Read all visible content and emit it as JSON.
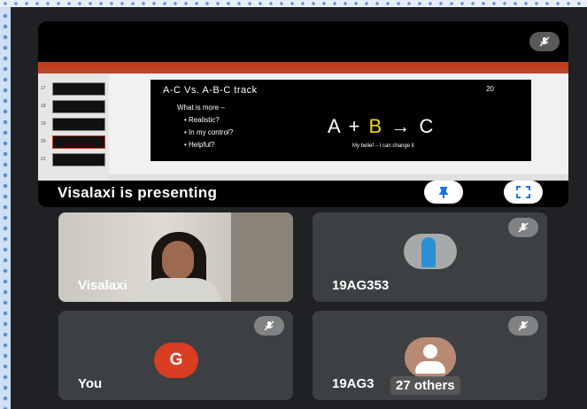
{
  "presentation": {
    "presenter_label": "Visalaxi is presenting",
    "slide": {
      "title": "A-C Vs. A-B-C track",
      "page_number": "20",
      "question": "What is more –",
      "bullets": [
        "Realistic?",
        "In my control?",
        "Helpful?"
      ],
      "equation_a": "A + ",
      "equation_b": "B",
      "equation_c": " → C",
      "caption": "My belief – I can change it"
    },
    "thumbnail_numbers": [
      "17",
      "18",
      "19",
      "20",
      "21"
    ]
  },
  "participants": [
    {
      "name": "Visalaxi"
    },
    {
      "name": "19AG353"
    },
    {
      "name": "You",
      "avatar_letter": "G"
    },
    {
      "name": "19AG3",
      "overlay": "27 others"
    }
  ],
  "colors": {
    "background": "#202124",
    "tile": "#3c4043",
    "you_avatar": "#d93d22",
    "ppt_accent": "#c43e1c"
  }
}
